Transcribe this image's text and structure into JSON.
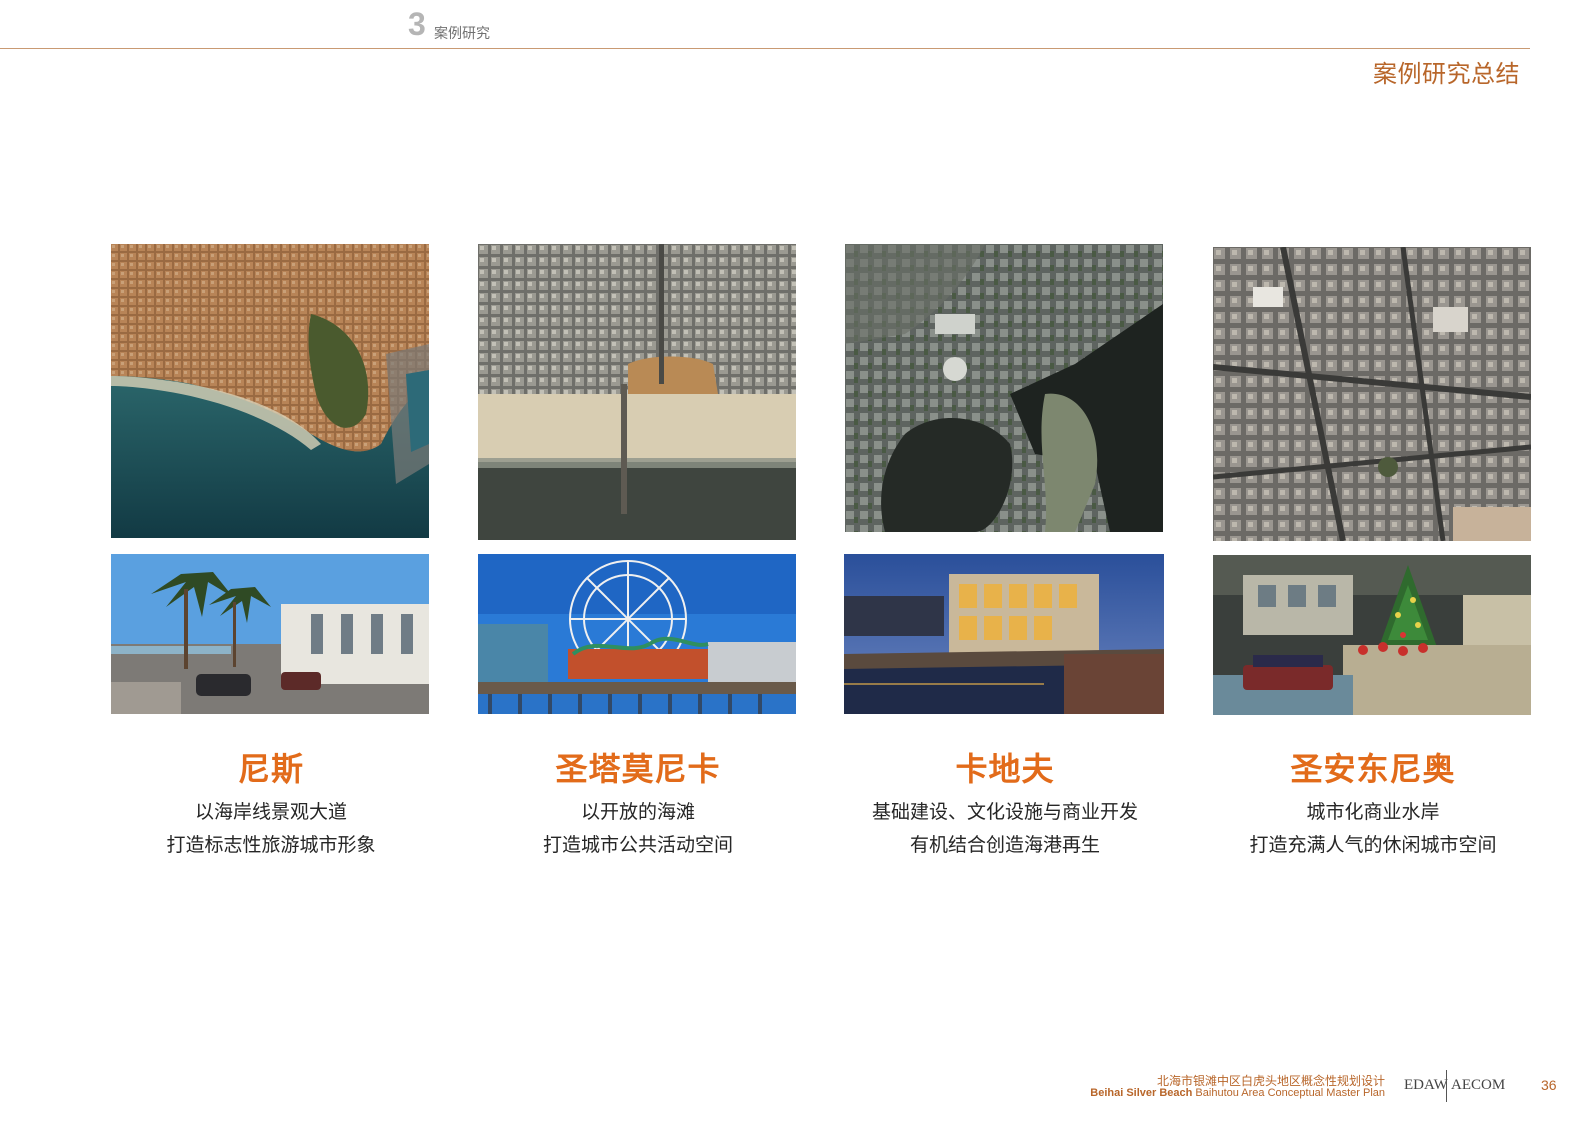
{
  "header": {
    "section_number": "3",
    "section_label": "案例研究",
    "page_title": "案例研究总结"
  },
  "cases": [
    {
      "name": "尼斯",
      "desc_line1": "以海岸线景观大道",
      "desc_line2": "打造标志性旅游城市形象",
      "aerial_image": "Nice coastline aerial photo",
      "street_image": "palm-lined promenade road photo"
    },
    {
      "name": "圣塔莫尼卡",
      "desc_line1": "以开放的海滩",
      "desc_line2": "打造城市公共活动空间",
      "aerial_image": "Santa Monica beach and pier aerial photo",
      "street_image": "ferris wheel on pier photo"
    },
    {
      "name": "卡地夫",
      "desc_line1": "基础建设、文化设施与商业开发",
      "desc_line2": "有机结合创造海港再生",
      "aerial_image": "Cardiff Bay harbour aerial photo",
      "street_image": "waterfront restaurants at dusk photo"
    },
    {
      "name": "圣安东尼奥",
      "desc_line1": "城市化商业水岸",
      "desc_line2": "打造充满人气的休闲城市空间",
      "aerial_image": "San Antonio downtown aerial photo",
      "street_image": "river walk with christmas tree photo"
    }
  ],
  "footer": {
    "project_cn": "北海市银滩中区白虎头地区概念性规划设计",
    "project_en_bold": "Beihai Silver Beach",
    "project_en_rest": " Baihutou Area Conceptual Master Plan",
    "logo_left": "EDAW",
    "logo_right": "AECOM",
    "page_number": "36"
  },
  "colors": {
    "accent_orange": "#e26b1a",
    "title_brown": "#b8662a",
    "rule": "#c99a73"
  }
}
